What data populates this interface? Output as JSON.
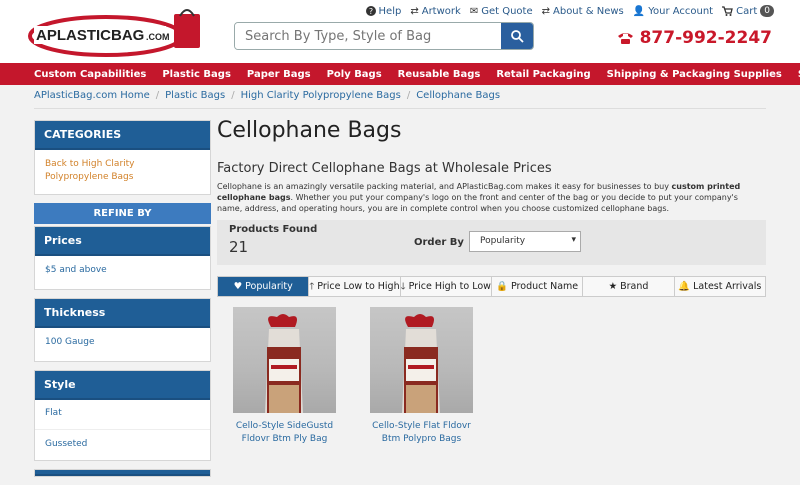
{
  "header": {
    "logo_text": "APLASTICBAG.COM",
    "search_placeholder": "Search By Type, Style of Bag",
    "links": {
      "help": "Help",
      "artwork": "Artwork",
      "quote": "Get Quote",
      "about": "About & News",
      "account": "Your Account",
      "cart": "Cart",
      "cart_count": "0"
    },
    "phone": "877-992-2247"
  },
  "nav": {
    "items": [
      "Custom Capabilities",
      "Plastic Bags",
      "Paper Bags",
      "Poly Bags",
      "Reusable Bags",
      "Retail Packaging",
      "Shipping & Packaging Supplies",
      "Sales"
    ]
  },
  "breadcrumb": [
    "APlasticBag.com Home",
    "Plastic Bags",
    "High Clarity Polypropylene Bags",
    "Cellophane Bags"
  ],
  "sidebar": {
    "categories_title": "CATEGORIES",
    "categories_link": "Back to High Clarity Polypropylene Bags",
    "refine_label": "REFINE BY",
    "prices_title": "Prices",
    "prices_item": "$5 and above",
    "thickness_title": "Thickness",
    "thickness_item": "100 Gauge",
    "style_title": "Style",
    "style_items": [
      "Flat",
      "Gusseted"
    ]
  },
  "main": {
    "title": "Cellophane Bags",
    "subtitle": "Factory Direct Cellophane Bags at Wholesale Prices",
    "desc_part1": "Cellophane is an amazingly versatile packing material, and APlasticBag.com makes it easy for businesses to buy ",
    "desc_bold": "custom printed cellophane bags",
    "desc_part2": ". Whether you put your company's logo on the front and center of the bag or you decide to put your company's name, address, and operating hours, you are in complete control when you choose customized cellophane bags.",
    "products_found_label": "Products Found",
    "products_found_value": "21",
    "order_by_label": "Order By",
    "order_by_value": "Popularity",
    "sort_tabs": [
      "Popularity",
      "Price Low to High",
      "Price High to Low",
      "Product Name",
      "Brand",
      "Latest Arrivals"
    ],
    "products": [
      {
        "name_line1": "Cello-Style SideGustd",
        "name_line2": "Fldovr Btm Ply Bag"
      },
      {
        "name_line1": "Cello-Style Flat Fldovr",
        "name_line2": "Btm Polypro Bags"
      }
    ]
  },
  "colors": {
    "brand_red": "#c4172c",
    "panel_blue": "#1f5e96",
    "link_blue": "#2a6aa0",
    "category_orange": "#d2822a"
  }
}
